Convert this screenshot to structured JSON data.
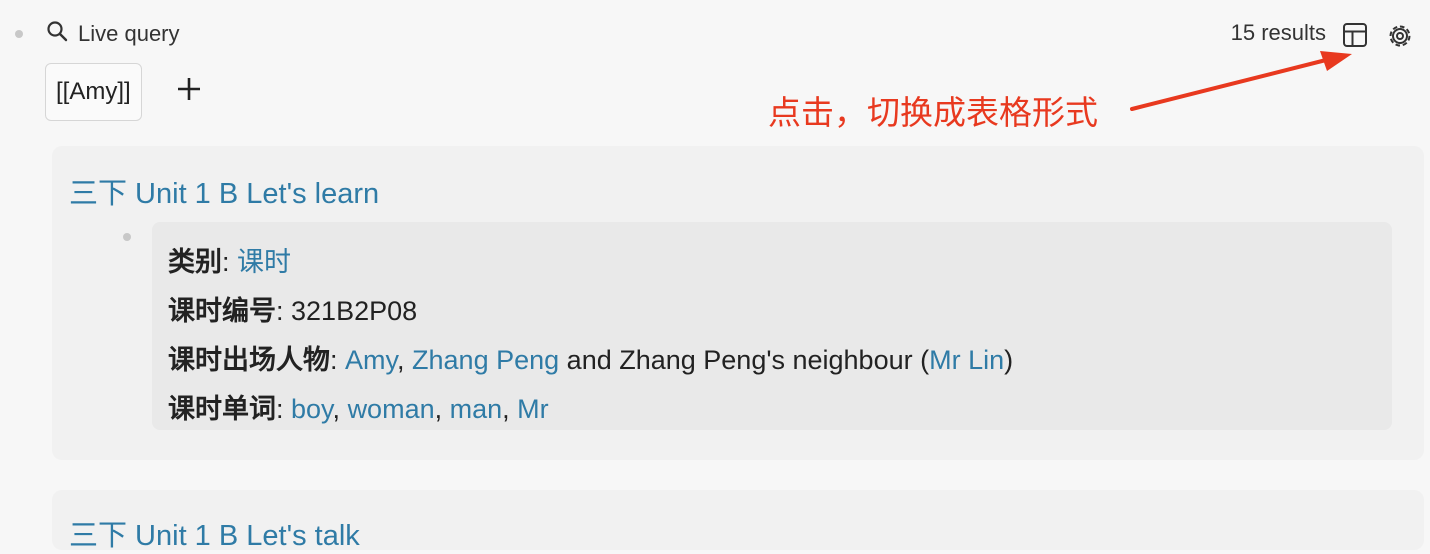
{
  "query": {
    "icon": "search-icon",
    "title": "Live query",
    "results": "15 results"
  },
  "toolbar": {
    "table_icon": "table-icon",
    "settings_icon": "gear-icon"
  },
  "filter": {
    "tag": "[[Amy]]",
    "add_icon": "plus-icon"
  },
  "annotation": {
    "text": "点击，切换成表格形式",
    "color": "#e8391f"
  },
  "results": [
    {
      "title": "三下 Unit 1 B Let's learn",
      "properties": {
        "category": {
          "key": "类别",
          "value": "课时"
        },
        "lesson_id": {
          "key": "课时编号",
          "value": "321B2P08"
        },
        "characters": {
          "key": "课时出场人物",
          "amy": "Amy",
          "zhang_peng": "Zhang Peng",
          "text_mid": "and Zhang Peng's neighbour",
          "mr_lin": "Mr Lin"
        },
        "words": {
          "key": "课时单词",
          "items": [
            "boy",
            "woman",
            "man",
            "Mr"
          ]
        }
      }
    },
    {
      "title": "三下 Unit 1 B Let's talk"
    }
  ],
  "colors": {
    "link": "#2f7ba6",
    "background": "#f7f7f7",
    "card": "#f1f1f1",
    "arrow": "#e8391f"
  }
}
